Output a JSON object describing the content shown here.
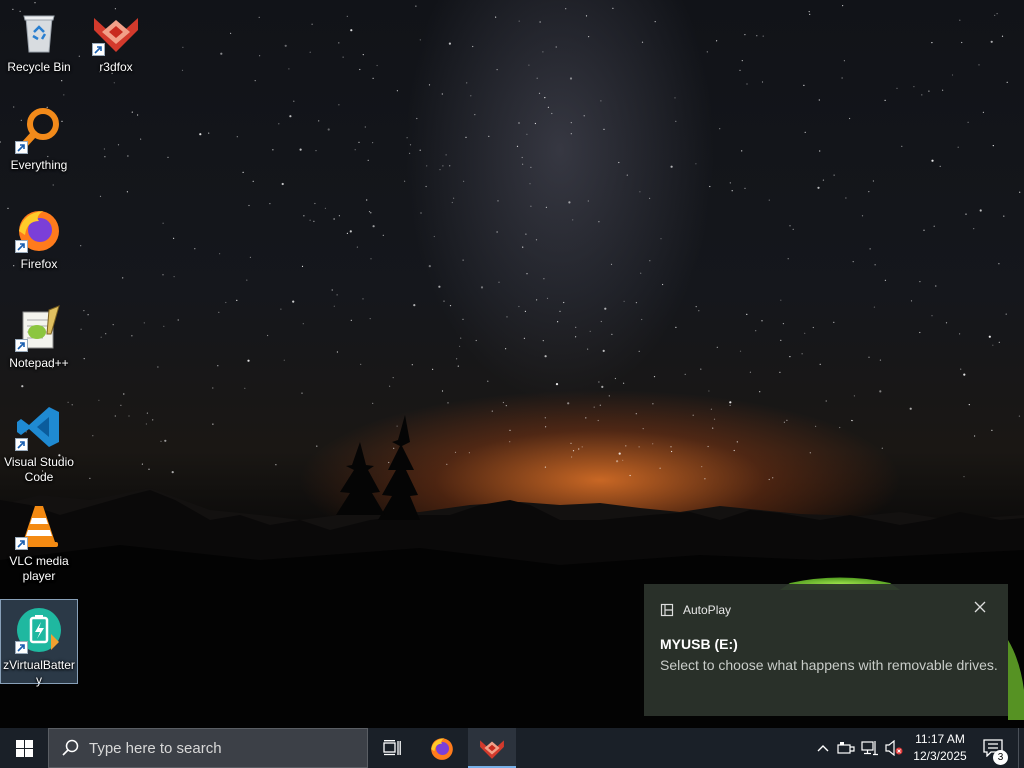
{
  "desktop": {
    "icons": [
      {
        "label": "Recycle Bin",
        "icon": "recycle-bin-icon"
      },
      {
        "label": "r3dfox",
        "icon": "r3dfox-icon"
      },
      {
        "label": "Everything",
        "icon": "everything-search-icon"
      },
      {
        "label": "Firefox",
        "icon": "firefox-icon"
      },
      {
        "label": "Notepad++",
        "icon": "notepad-plus-plus-icon"
      },
      {
        "label": "Visual Studio Code",
        "icon": "vscode-icon"
      },
      {
        "label": "VLC media player",
        "icon": "vlc-icon"
      },
      {
        "label": "zVirtualBattery",
        "icon": "zvirtualbattery-icon",
        "selected": true
      }
    ]
  },
  "toast": {
    "app": "AutoPlay",
    "title": "MYUSB (E:)",
    "message": "Select to choose what happens with removable drives."
  },
  "taskbar": {
    "search_placeholder": "Type here to search",
    "pinned": [
      "task-view-icon",
      "firefox-icon",
      "r3dfox-icon"
    ],
    "active_app": "r3dfox",
    "tray_icons": [
      "chevron-up-icon",
      "usb-drive-icon",
      "network-icon",
      "volume-muted-icon"
    ],
    "time": "11:17 AM",
    "date": "12/3/2025",
    "notification_count": "3"
  },
  "colors": {
    "taskbar": "#1a2028",
    "toast_bg": "#2c342c",
    "accent": "#77b0e8"
  }
}
